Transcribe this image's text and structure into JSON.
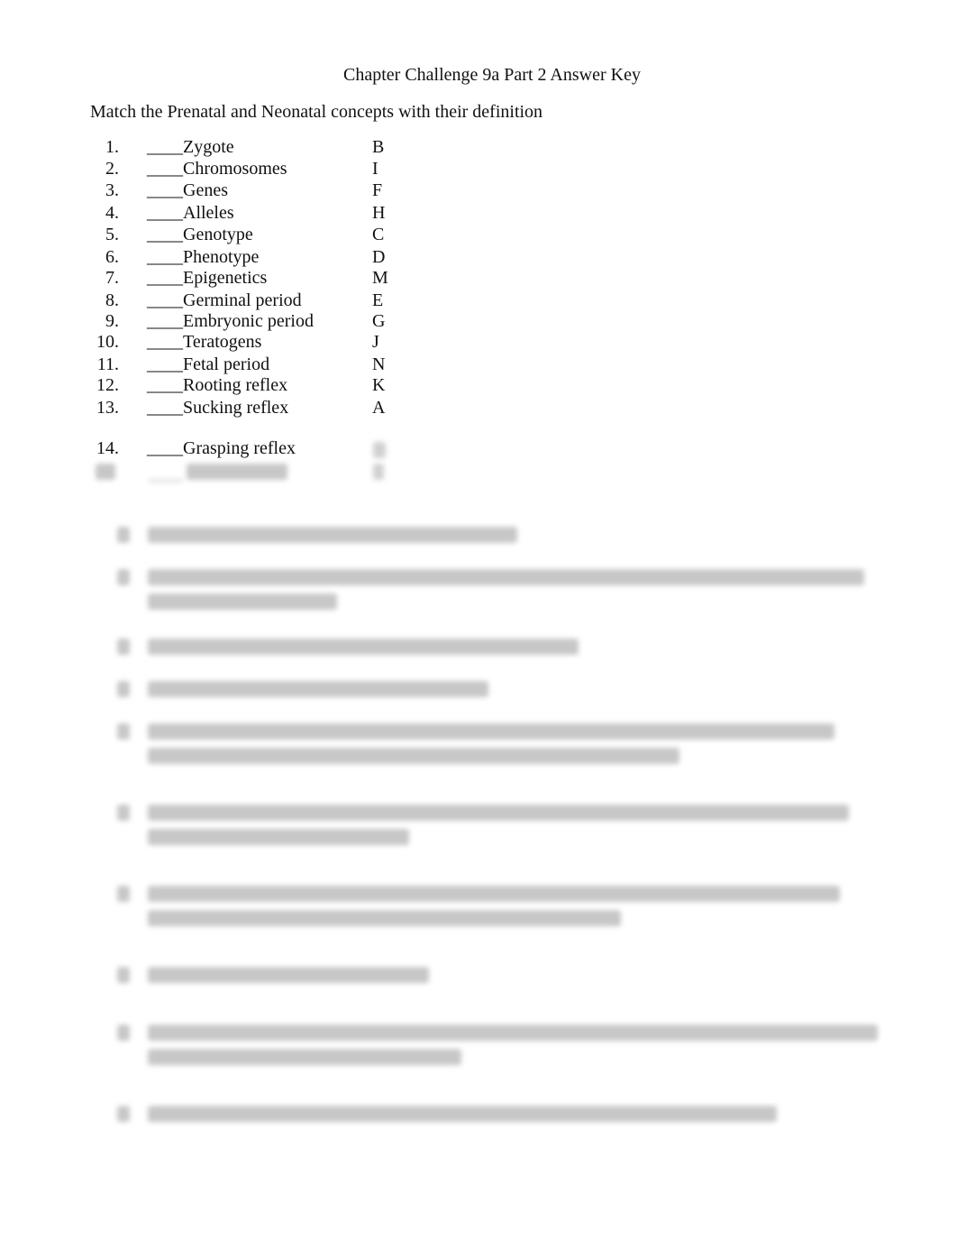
{
  "document": {
    "title": "Chapter Challenge 9a Part 2 Answer Key",
    "instructions": "Match the Prenatal and Neonatal concepts with their definition",
    "blank": "____",
    "items": [
      {
        "number": "1.",
        "term": "Zygote",
        "answer": "B"
      },
      {
        "number": "2.",
        "term": "Chromosomes",
        "answer": "I"
      },
      {
        "number": "3.",
        "term": "Genes",
        "answer": "F"
      },
      {
        "number": "4.",
        "term": "Alleles",
        "answer": "H"
      },
      {
        "number": "5.",
        "term": "Genotype",
        "answer": "C"
      },
      {
        "number": "6.",
        "term": "Phenotype",
        "answer": "D"
      },
      {
        "number": "7.",
        "term": "Epigenetics",
        "answer": "M"
      },
      {
        "number": "8.",
        "term": "Germinal period",
        "answer": "E"
      },
      {
        "number": "9.",
        "term": "Embryonic period",
        "answer": "G"
      },
      {
        "number": "10.",
        "term": "Teratogens",
        "answer": "J"
      },
      {
        "number": "11.",
        "term": "Fetal period",
        "answer": "N"
      },
      {
        "number": "12.",
        "term": "Rooting reflex",
        "answer": "K"
      },
      {
        "number": "13.",
        "term": "Sucking reflex",
        "answer": "A"
      },
      {
        "number": "14.",
        "term": "Grasping reflex",
        "answer": ""
      }
    ],
    "blurred_notice": "Definitions section is blurred (not legible)"
  }
}
